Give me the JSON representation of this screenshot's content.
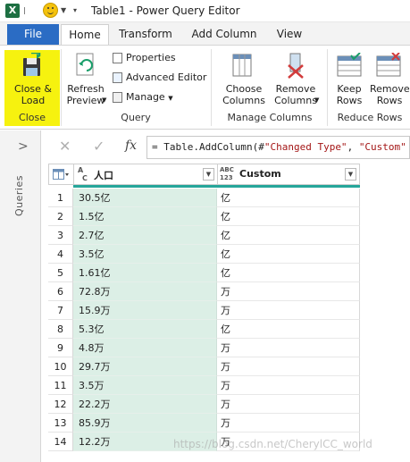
{
  "window": {
    "title": "Table1 - Power Query Editor"
  },
  "tabs": {
    "file": "File",
    "items": [
      "Home",
      "Transform",
      "Add Column",
      "View"
    ]
  },
  "ribbon": {
    "close_load": "Close &\nLoad",
    "close_group": "Close",
    "refresh_preview": "Refresh\nPreview",
    "properties": "Properties",
    "advanced_editor": "Advanced Editor",
    "manage": "Manage",
    "query_group": "Query",
    "choose_columns": "Choose\nColumns",
    "remove_columns": "Remove\nColumns",
    "manage_columns_group": "Manage Columns",
    "keep_rows": "Keep\nRows",
    "remove_rows": "Remove\nRows",
    "reduce_rows_group": "Reduce Rows"
  },
  "queries_pane": {
    "label": "Queries",
    "toggle": ">"
  },
  "formula_bar": {
    "fx": "fx",
    "prefix": "= Table.AddColumn(#",
    "str1": "\"Changed Type\"",
    "mid": ", ",
    "str2": "\"Custom\""
  },
  "table": {
    "columns": [
      {
        "type": "ABC",
        "name": "人口"
      },
      {
        "type": "ABC\n123",
        "name": "Custom"
      }
    ],
    "rows": [
      {
        "n": "1",
        "pop": "30.5亿",
        "custom": "亿"
      },
      {
        "n": "2",
        "pop": "1.5亿",
        "custom": "亿"
      },
      {
        "n": "3",
        "pop": "2.7亿",
        "custom": "亿"
      },
      {
        "n": "4",
        "pop": "3.5亿",
        "custom": "亿"
      },
      {
        "n": "5",
        "pop": "1.61亿",
        "custom": "亿"
      },
      {
        "n": "6",
        "pop": "72.8万",
        "custom": "万"
      },
      {
        "n": "7",
        "pop": "15.9万",
        "custom": "万"
      },
      {
        "n": "8",
        "pop": "5.3亿",
        "custom": "亿"
      },
      {
        "n": "9",
        "pop": "4.8万",
        "custom": "万"
      },
      {
        "n": "10",
        "pop": "29.7万",
        "custom": "万"
      },
      {
        "n": "11",
        "pop": "3.5万",
        "custom": "万"
      },
      {
        "n": "12",
        "pop": "22.2万",
        "custom": "万"
      },
      {
        "n": "13",
        "pop": "85.9万",
        "custom": "万"
      },
      {
        "n": "14",
        "pop": "12.2万",
        "custom": "万"
      }
    ]
  },
  "watermark": "https://blog.csdn.net/CherylCC_world",
  "colors": {
    "file_tab": "#2b6cc4",
    "highlight": "#f6f20f",
    "column_selected": "#dcefe6",
    "header_bar": "#26a69a"
  }
}
